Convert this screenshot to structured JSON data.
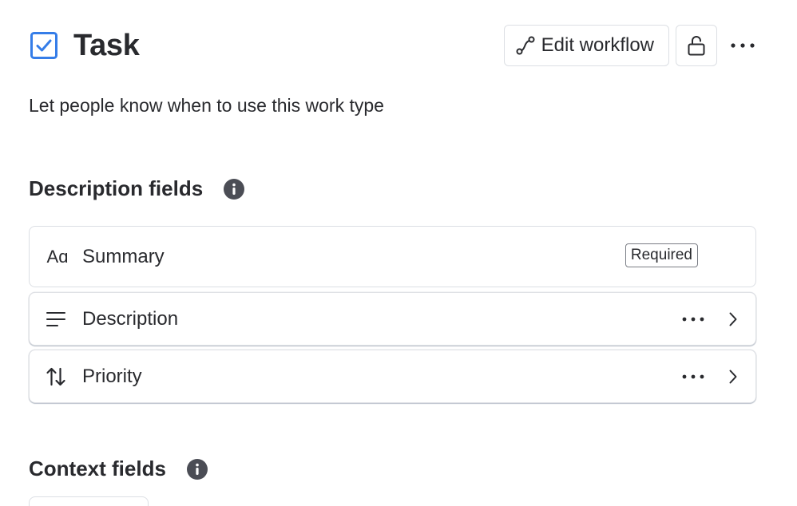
{
  "header": {
    "title": "Task",
    "type_icon": "checkbox-icon",
    "edit_workflow_label": "Edit workflow",
    "workflow_icon": "workflow-icon",
    "lock_icon": "unlock-icon",
    "more_icon": "more-horizontal-icon"
  },
  "subtitle": "Let people know when to use this work type",
  "description_fields": {
    "title": "Description fields",
    "info_icon": "info-icon",
    "items": [
      {
        "label": "Summary",
        "icon": "text-aa-icon",
        "icon_text": "Aɑ",
        "badge": "Required"
      },
      {
        "label": "Description",
        "icon": "lines-icon"
      },
      {
        "label": "Priority",
        "icon": "sort-arrows-icon"
      }
    ]
  },
  "context_fields": {
    "title": "Context fields",
    "info_icon": "info-icon"
  },
  "colors": {
    "accent": "#357de8",
    "text": "#292a2e",
    "border": "#dcdfe4",
    "info_bg": "#4b4d55"
  }
}
